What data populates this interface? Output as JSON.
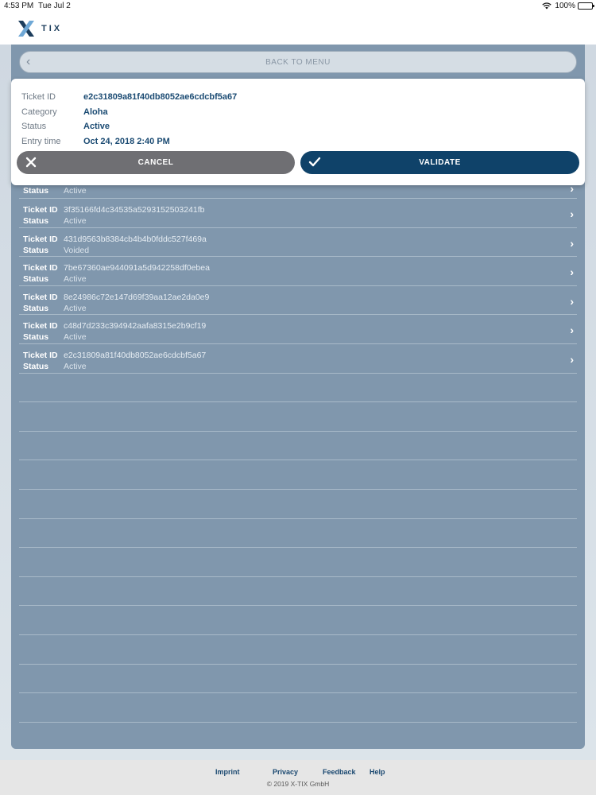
{
  "status_bar": {
    "time": "4:53 PM",
    "date": "Tue Jul 2",
    "battery": "100%"
  },
  "header": {
    "logo_text": "TIX"
  },
  "navigation": {
    "back_label": "BACK TO MENU"
  },
  "ticket_detail": {
    "rows": [
      {
        "label": "Ticket ID",
        "value": "e2c31809a81f40db8052ae6cdcbf5a67"
      },
      {
        "label": "Category",
        "value": "Aloha"
      },
      {
        "label": "Status",
        "value": "Active"
      },
      {
        "label": "Entry time",
        "value": "Oct 24, 2018 2:40 PM"
      }
    ],
    "cancel_label": "CANCEL",
    "validate_label": "VALIDATE"
  },
  "ticket_list": {
    "ticket_label": "Ticket ID",
    "status_label": "Status",
    "partial_row": {
      "status": "Active"
    },
    "items": [
      {
        "id": "3f35166fd4c34535a5293152503241fb",
        "status": "Active"
      },
      {
        "id": "431d9563b8384cb4b4b0fddc527f469a",
        "status": "Voided"
      },
      {
        "id": "7be67360ae944091a5d942258df0ebea",
        "status": "Active"
      },
      {
        "id": "8e24986c72e147d69f39aa12ae2da0e9",
        "status": "Active"
      },
      {
        "id": "c48d7d233c394942aafa8315e2b9cf19",
        "status": "Active"
      },
      {
        "id": "e2c31809a81f40db8052ae6cdcbf5a67",
        "status": "Active"
      }
    ]
  },
  "footer": {
    "links": [
      "Imprint",
      "Privacy",
      "Feedback",
      "Help"
    ],
    "copyright": "© 2019 X-TIX GmbH"
  },
  "colors": {
    "primary": "#0f4269",
    "cancel": "#6f6f73",
    "panel": "#8097ad"
  }
}
